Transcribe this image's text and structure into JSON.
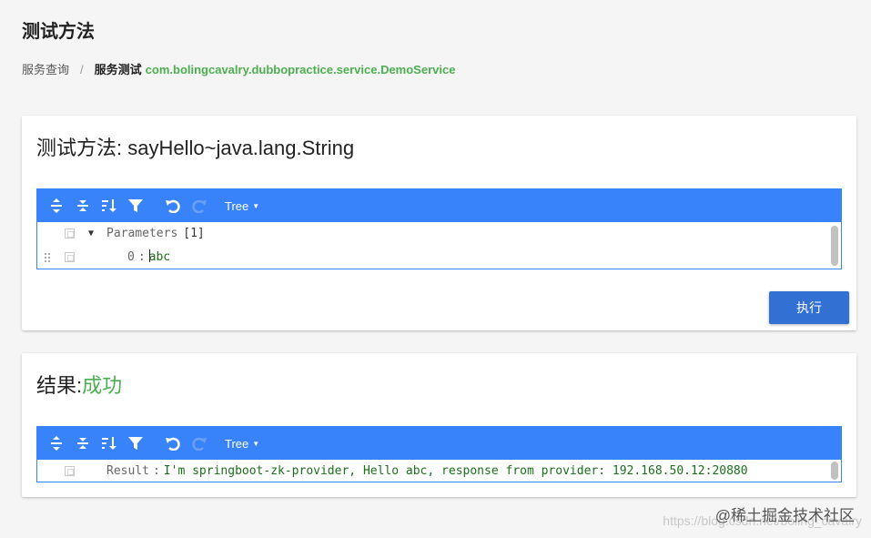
{
  "page": {
    "title": "测试方法"
  },
  "breadcrumb": {
    "home": "服务查询",
    "separator": "/",
    "current": "服务测试",
    "service": "com.bolingcavalry.dubbopractice.service.DemoService"
  },
  "method_card": {
    "title": "测试方法: sayHello~java.lang.String",
    "editor": {
      "mode_label": "Tree",
      "tree": {
        "root_label": "Parameters",
        "root_count": "[1]",
        "items": [
          {
            "key": "0",
            "value": "abc"
          }
        ]
      }
    },
    "execute_label": "执行"
  },
  "result_card": {
    "title_prefix": "结果:",
    "status": "成功",
    "editor": {
      "mode_label": "Tree",
      "tree": {
        "key": "Result",
        "value": "I'm springboot-zk-provider, Hello abc, response from provider: 192.168.50.12:20880"
      }
    }
  },
  "watermark": {
    "text": "@稀土掘金技术社区",
    "url": "https://blog.csdn.net/boling_cavalry"
  },
  "colors": {
    "toolbar": "#3883fa",
    "button": "#3370d3",
    "success": "#4caf50",
    "value": "#1a6f1a"
  },
  "icons": [
    "expand-all-icon",
    "collapse-all-icon",
    "sort-icon",
    "filter-icon",
    "undo-icon",
    "redo-icon",
    "drag-handle-icon",
    "context-menu-icon",
    "expand-arrow-icon"
  ]
}
